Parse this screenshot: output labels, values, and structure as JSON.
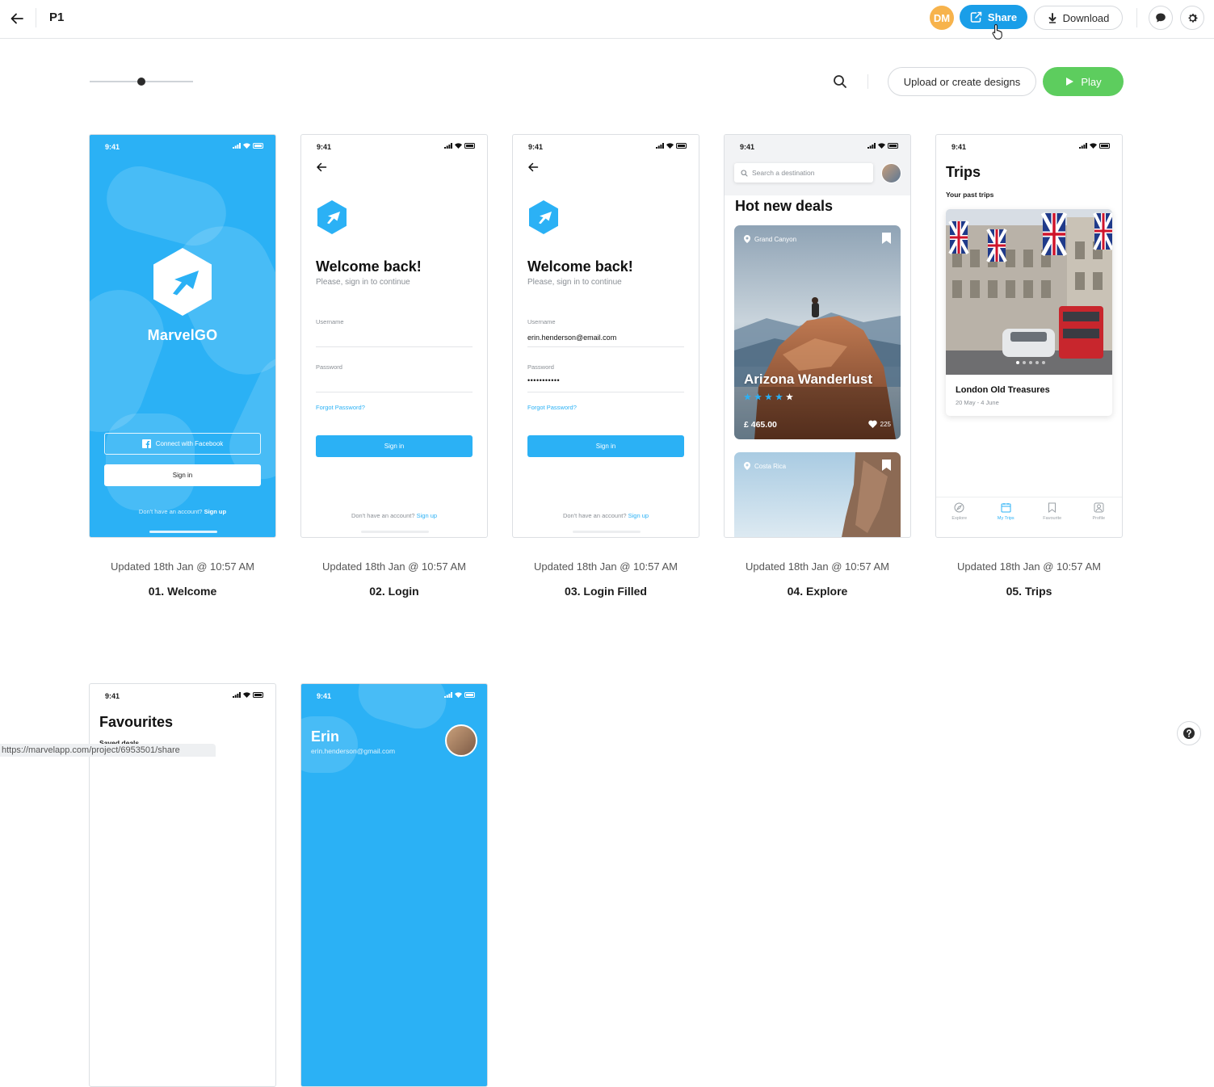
{
  "topbar": {
    "project_title": "P1",
    "avatar_initials": "DM",
    "share_label": "Share",
    "download_label": "Download"
  },
  "toolbar": {
    "zoom_level": 0.5,
    "upload_label": "Upload or create designs",
    "play_label": "Play"
  },
  "colors": {
    "brand_blue": "#2bb1f5",
    "share_blue": "#1a9ee8",
    "play_green": "#5dcd5e",
    "avatar_orange": "#f7b34c"
  },
  "screens": [
    {
      "updated": "Updated 18th Jan @ 10:57 AM",
      "title": "01. Welcome",
      "status_time": "9:41",
      "brand": "MarvelGO",
      "facebook_btn": "Connect with Facebook",
      "signin_btn": "Sign in",
      "no_account": "Don't have an account?",
      "signup_link": "Sign up"
    },
    {
      "updated": "Updated 18th Jan @ 10:57 AM",
      "title": "02. Login",
      "status_time": "9:41",
      "heading": "Welcome back!",
      "subheading": "Please, sign in to continue",
      "username_label": "Username",
      "username_value": "",
      "password_label": "Password",
      "password_value": "",
      "forgot": "Forgot Password?",
      "signin_btn": "Sign in",
      "no_account": "Don't have an account?",
      "signup_link": "Sign up"
    },
    {
      "updated": "Updated 18th Jan @ 10:57 AM",
      "title": "03. Login Filled",
      "status_time": "9:41",
      "heading": "Welcome back!",
      "subheading": "Please, sign in to continue",
      "username_label": "Username",
      "username_value": "erin.henderson@email.com",
      "password_label": "Password",
      "password_value": "•••••••••••",
      "forgot": "Forgot Password?",
      "signin_btn": "Sign in",
      "no_account": "Don't have an account?",
      "signup_link": "Sign up"
    },
    {
      "updated": "Updated 18th Jan @ 10:57 AM",
      "title": "04. Explore",
      "status_time": "9:41",
      "search_placeholder": "Search a destination",
      "heading": "Hot new deals",
      "deal1_location": "Grand Canyon",
      "deal1_name": "Arizona Wanderlust",
      "deal1_rating": 4,
      "deal1_price": "£ 465.00",
      "deal1_likes": "225",
      "deal2_location": "Costa Rica"
    },
    {
      "updated": "Updated 18th Jan @ 10:57 AM",
      "title": "05. Trips",
      "status_time": "9:41",
      "heading": "Trips",
      "subheading": "Your past trips",
      "trip_name": "London Old Treasures",
      "trip_dates": "20 May - 4 June",
      "tabs": [
        "Explore",
        "My Trips",
        "Favourite",
        "Profile"
      ]
    },
    {
      "status_time": "9:41",
      "heading": "Favourites",
      "subheading": "Saved deals"
    },
    {
      "status_time": "9:41",
      "profile_name": "Erin",
      "profile_email": "erin.henderson@gmail.com"
    }
  ],
  "status_url": "https://marvelapp.com/project/6953501/share"
}
